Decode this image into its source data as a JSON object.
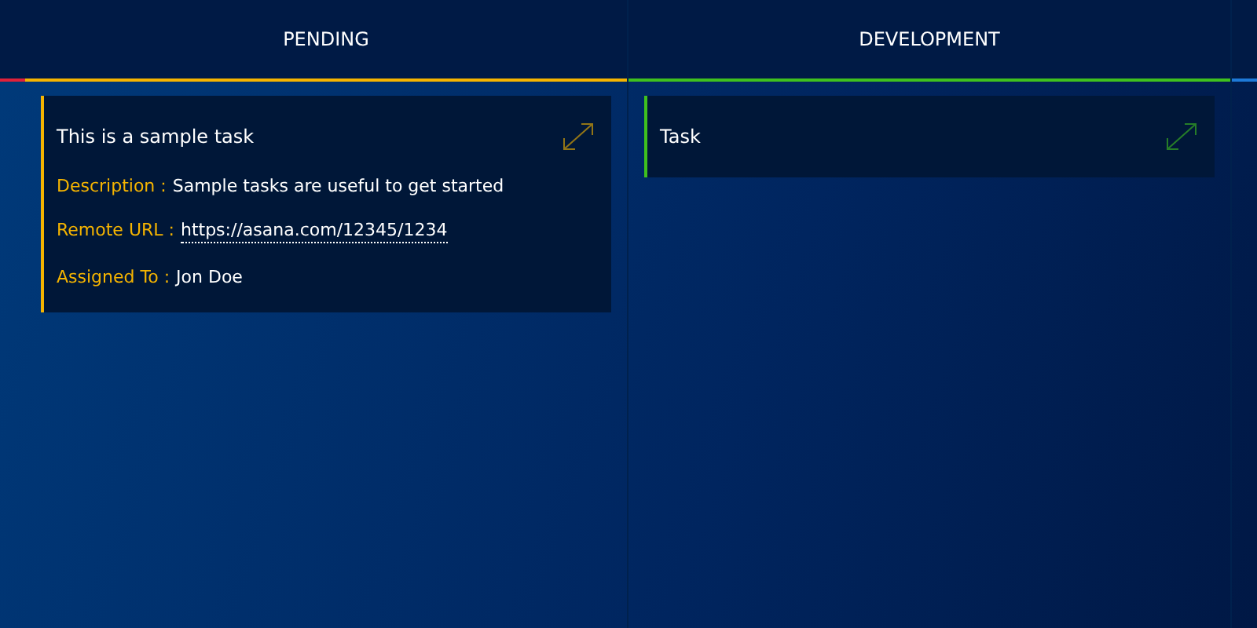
{
  "lanes": [
    {
      "color": "#e0213a"
    },
    {
      "title": "PENDING",
      "color": "#f5b400",
      "cards": [
        {
          "title": "This is a sample task",
          "fields": [
            {
              "label": "Description :",
              "value": "Sample tasks are useful to get started",
              "kind": "text"
            },
            {
              "label": "Remote URL :",
              "value": "https://asana.com/12345/1234",
              "kind": "link"
            },
            {
              "label": "Assigned To :",
              "value": "Jon Doe",
              "kind": "text"
            }
          ]
        }
      ]
    },
    {
      "title": "DEVELOPMENT",
      "color": "#3fc11e",
      "cards": [
        {
          "title": "Task"
        }
      ]
    },
    {
      "color": "#1e7ad8"
    }
  ]
}
